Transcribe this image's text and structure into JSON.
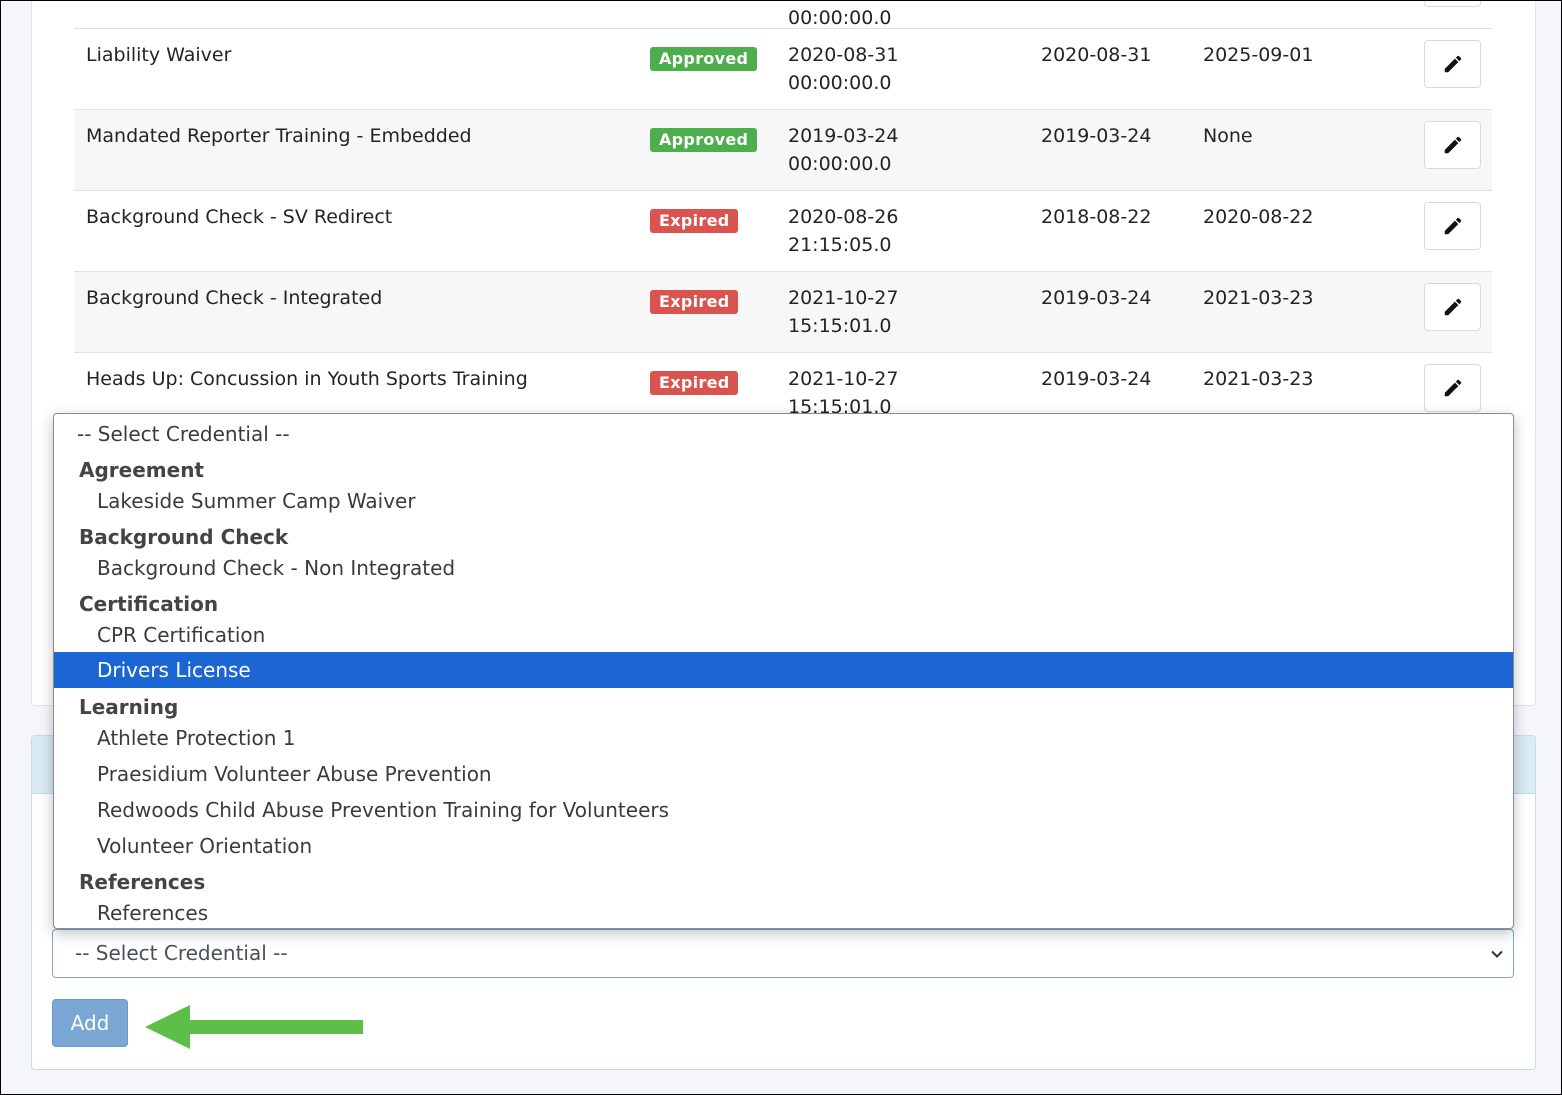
{
  "table": {
    "rows": [
      {
        "name": "",
        "status": "",
        "submitted_date": "",
        "submitted_time": "00:00:00.0",
        "start": "",
        "end": ""
      },
      {
        "name": "Liability Waiver",
        "status": "Approved",
        "submitted_date": "2020-08-31",
        "submitted_time": "00:00:00.0",
        "start": "2020-08-31",
        "end": "2025-09-01"
      },
      {
        "name": "Mandated Reporter Training - Embedded",
        "status": "Approved",
        "submitted_date": "2019-03-24",
        "submitted_time": "00:00:00.0",
        "start": "2019-03-24",
        "end": "None"
      },
      {
        "name": "Background Check - SV Redirect",
        "status": "Expired",
        "submitted_date": "2020-08-26",
        "submitted_time": "21:15:05.0",
        "start": "2018-08-22",
        "end": "2020-08-22"
      },
      {
        "name": "Background Check - Integrated",
        "status": "Expired",
        "submitted_date": "2021-10-27",
        "submitted_time": "15:15:01.0",
        "start": "2019-03-24",
        "end": "2021-03-23"
      },
      {
        "name": "Heads Up: Concussion in Youth Sports Training",
        "status": "Expired",
        "submitted_date": "2021-10-27",
        "submitted_time": "15:15:01.0",
        "start": "2019-03-24",
        "end": "2021-03-23"
      }
    ]
  },
  "colors": {
    "approved": "#4cae4c",
    "expired": "#d9534f",
    "selected": "#1b66d3",
    "add_button": "#7aa6d4",
    "arrow": "#5cbf4a"
  },
  "dropdown": {
    "placeholder": "-- Select Credential --",
    "groups": [
      {
        "label": "Agreement",
        "options": [
          "Lakeside Summer Camp Waiver"
        ]
      },
      {
        "label": "Background Check",
        "options": [
          "Background Check - Non Integrated"
        ]
      },
      {
        "label": "Certification",
        "options": [
          "CPR Certification",
          "Drivers License"
        ]
      },
      {
        "label": "Learning",
        "options": [
          "Athlete Protection 1",
          "Praesidium Volunteer Abuse Prevention",
          "Redwoods Child Abuse Prevention Training for Volunteers",
          "Volunteer Orientation"
        ]
      },
      {
        "label": "References",
        "options": [
          "References"
        ]
      }
    ],
    "highlighted": "Drivers License"
  },
  "select": {
    "value": "-- Select Credential --"
  },
  "add_button": {
    "label": "Add"
  },
  "icons": {
    "edit": "pencil-icon",
    "chevron": "chevron-down-icon",
    "annotation": "green-arrow-left"
  }
}
